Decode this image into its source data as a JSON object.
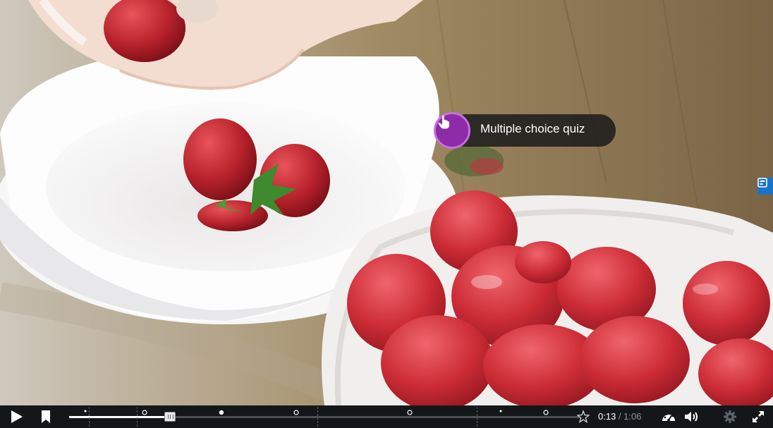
{
  "player": {
    "quiz_hotspot": {
      "label": "Multiple choice quiz",
      "color": "#8e2ba8"
    },
    "controls": {
      "current_time": "0:13",
      "separator": " / ",
      "duration": "1:06",
      "progress_fraction": 0.197
    },
    "icons": {
      "play": "play-icon",
      "bookmark": "bookmark-icon",
      "interaction_marker": "interaction-marker-icon",
      "endscreen": "star-icon",
      "speed": "gauge-icon",
      "volume": "volume-icon",
      "settings": "gear-icon",
      "fullscreen": "fullscreen-icon",
      "side_panel": "panel-icon"
    },
    "accent_colors": {
      "controlbar_bg": "#14171a",
      "side_tab": "#1a73c9",
      "duration_text": "#8c929a"
    }
  }
}
